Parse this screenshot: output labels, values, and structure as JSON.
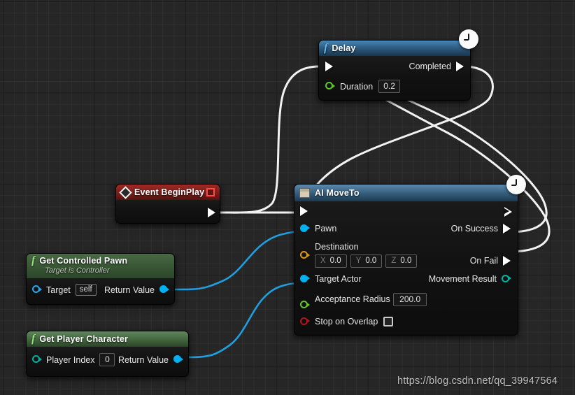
{
  "app": {
    "editor": "Unreal Engine Blueprint Graph",
    "watermark": "https://blog.csdn.net/qq_39947564"
  },
  "nodes": {
    "delay": {
      "title": "Delay",
      "icon": "function-f-icon",
      "exec_in": "",
      "exec_out": "Completed",
      "inputs": [
        {
          "label": "Duration",
          "value": "0.2",
          "pin": "green-float-pin"
        }
      ],
      "badge": "latent-clock-icon"
    },
    "event_begin_play": {
      "title": "Event BeginPlay",
      "icon": "event-diamond-icon",
      "stop_icon": "stop-square-icon",
      "exec_out": ""
    },
    "ai_move_to": {
      "title": "AI MoveTo",
      "icon": "latent-node-icon",
      "badge": "latent-clock-icon",
      "exec_in": "",
      "exec_out": "",
      "inputs": [
        {
          "label": "Pawn",
          "pin": "blue-object-pin"
        },
        {
          "label": "Destination",
          "pin": "orange-struct-pin",
          "vector": {
            "x_axis": "X",
            "x_value": "0.0",
            "y_axis": "Y",
            "y_value": "0.0",
            "z_axis": "Z",
            "z_value": "0.0"
          }
        },
        {
          "label": "Target Actor",
          "pin": "blue-object-pin"
        },
        {
          "label": "Acceptance Radius",
          "pin": "green-float-pin",
          "value": "200.0"
        },
        {
          "label": "Stop on Overlap",
          "pin": "red-bool-pin",
          "checked": false
        }
      ],
      "outputs": [
        {
          "label": "On Success",
          "pin": "exec-pin"
        },
        {
          "label": "On Fail",
          "pin": "exec-pin"
        },
        {
          "label": "Movement Result",
          "pin": "teal-enum-pin"
        }
      ]
    },
    "get_controlled_pawn": {
      "title": "Get Controlled Pawn",
      "subtitle": "Target is Controller",
      "icon": "function-f-icon",
      "input": {
        "label": "Target",
        "value": "self",
        "pin": "blue-object-pin"
      },
      "output": {
        "label": "Return Value",
        "pin": "blue-object-pin"
      }
    },
    "get_player_character": {
      "title": "Get Player Character",
      "icon": "function-f-icon",
      "input": {
        "label": "Player Index",
        "value": "0",
        "pin": "teal-int-pin"
      },
      "output": {
        "label": "Return Value",
        "pin": "blue-object-pin"
      }
    }
  },
  "colors": {
    "exec_wire": "#f2f2f2",
    "data_wire": "#1f9ee0",
    "canvas_bg": "#262626",
    "blue_pin": "#00b0f0",
    "green_pin": "#5ccc22",
    "orange_pin": "#dd9a11",
    "red_pin": "#b8151b",
    "teal_pin": "#00b3a0"
  }
}
